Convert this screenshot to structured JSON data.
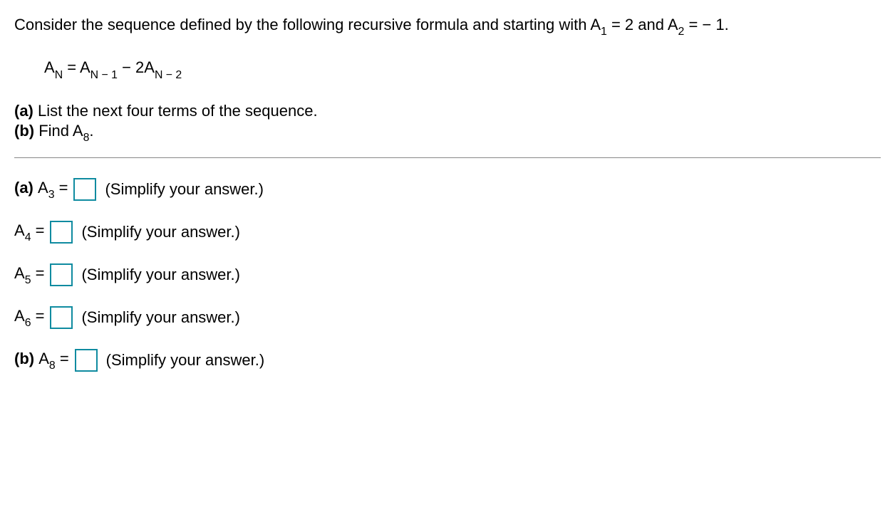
{
  "intro": {
    "prefix": "Consider the sequence defined by the following recursive formula and starting with A",
    "sub1": "1",
    "mid1": " = 2 and A",
    "sub2": "2",
    "suffix": " = − 1."
  },
  "formula": {
    "lhsA": "A",
    "lhsSub": "N",
    "eq": " = A",
    "rhs1Sub": "N − 1",
    "minus": " − 2A",
    "rhs2Sub": "N − 2"
  },
  "parts": {
    "a_label": "(a)",
    "a_text": " List the next four terms of the sequence.",
    "b_label": "(b)",
    "b_text": " Find A",
    "b_sub": "8",
    "b_end": "."
  },
  "answers": [
    {
      "pre_label": "(a)",
      "pre_label_bold": true,
      "var": "A",
      "sub": "3",
      "post": "=",
      "hint": "(Simplify your answer.)"
    },
    {
      "pre_label": "",
      "pre_label_bold": false,
      "var": "A",
      "sub": "4",
      "post": "=",
      "hint": "(Simplify your answer.)"
    },
    {
      "pre_label": "",
      "pre_label_bold": false,
      "var": "A",
      "sub": "5",
      "post": "=",
      "hint": "(Simplify your answer.)"
    },
    {
      "pre_label": "",
      "pre_label_bold": false,
      "var": "A",
      "sub": "6",
      "post": "=",
      "hint": "(Simplify your answer.)"
    },
    {
      "pre_label": "(b)",
      "pre_label_bold": true,
      "var": "A",
      "sub": "8",
      "post": "=",
      "hint": "(Simplify your answer.)"
    }
  ]
}
